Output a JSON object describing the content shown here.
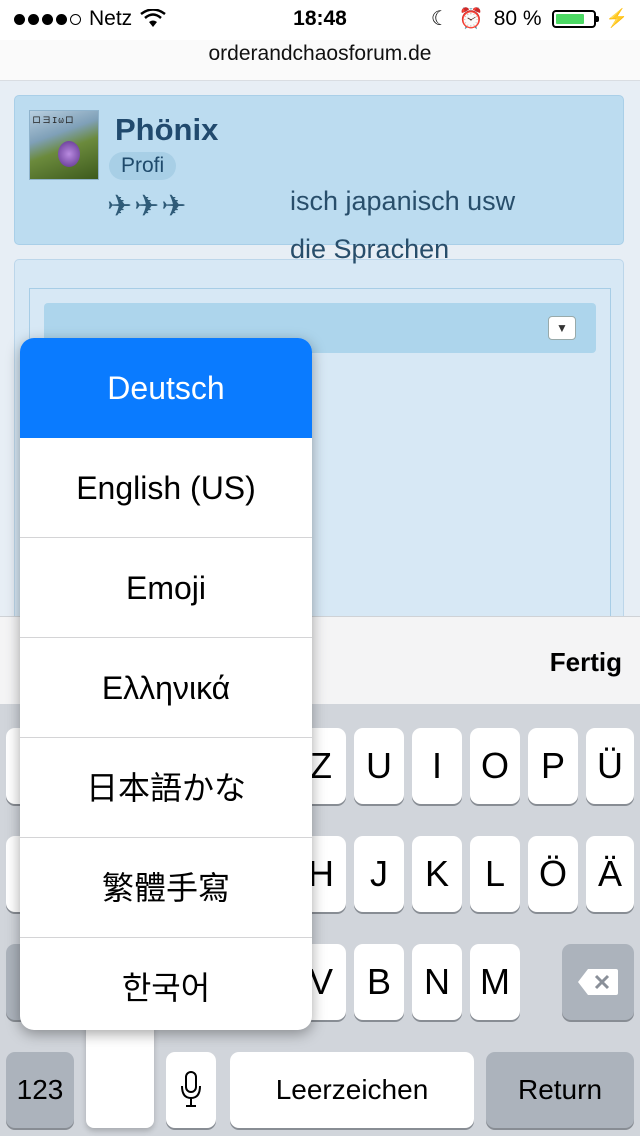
{
  "status_bar": {
    "carrier": "Netz",
    "time": "18:48",
    "battery": "80 %",
    "battery_level": 0.8
  },
  "browser": {
    "url": "orderandchaosforum.de"
  },
  "post": {
    "username": "Phönix",
    "rank": "Profi",
    "text_line1": "isch japanisch usw",
    "text_line2": "die Sprachen"
  },
  "accessory": {
    "done": "Fertig"
  },
  "keyboard": {
    "row1": [
      "Z",
      "U",
      "I",
      "O",
      "P",
      "Ü"
    ],
    "row2": [
      "H",
      "J",
      "K",
      "L",
      "Ö",
      "Ä"
    ],
    "row3": [
      "V",
      "B",
      "N",
      "M"
    ],
    "numbers": "123",
    "space": "Leerzeichen",
    "return": "Return"
  },
  "language_menu": {
    "items": [
      "Deutsch",
      "English (US)",
      "Emoji",
      "Ελληνικά",
      "日本語かな",
      "繁體手寫",
      "한국어"
    ],
    "selected": "Deutsch"
  },
  "icons": [
    "wifi-icon",
    "moon-icon",
    "alarm-icon",
    "battery-icon",
    "dropdown-icon",
    "mic-icon",
    "backspace-icon"
  ]
}
